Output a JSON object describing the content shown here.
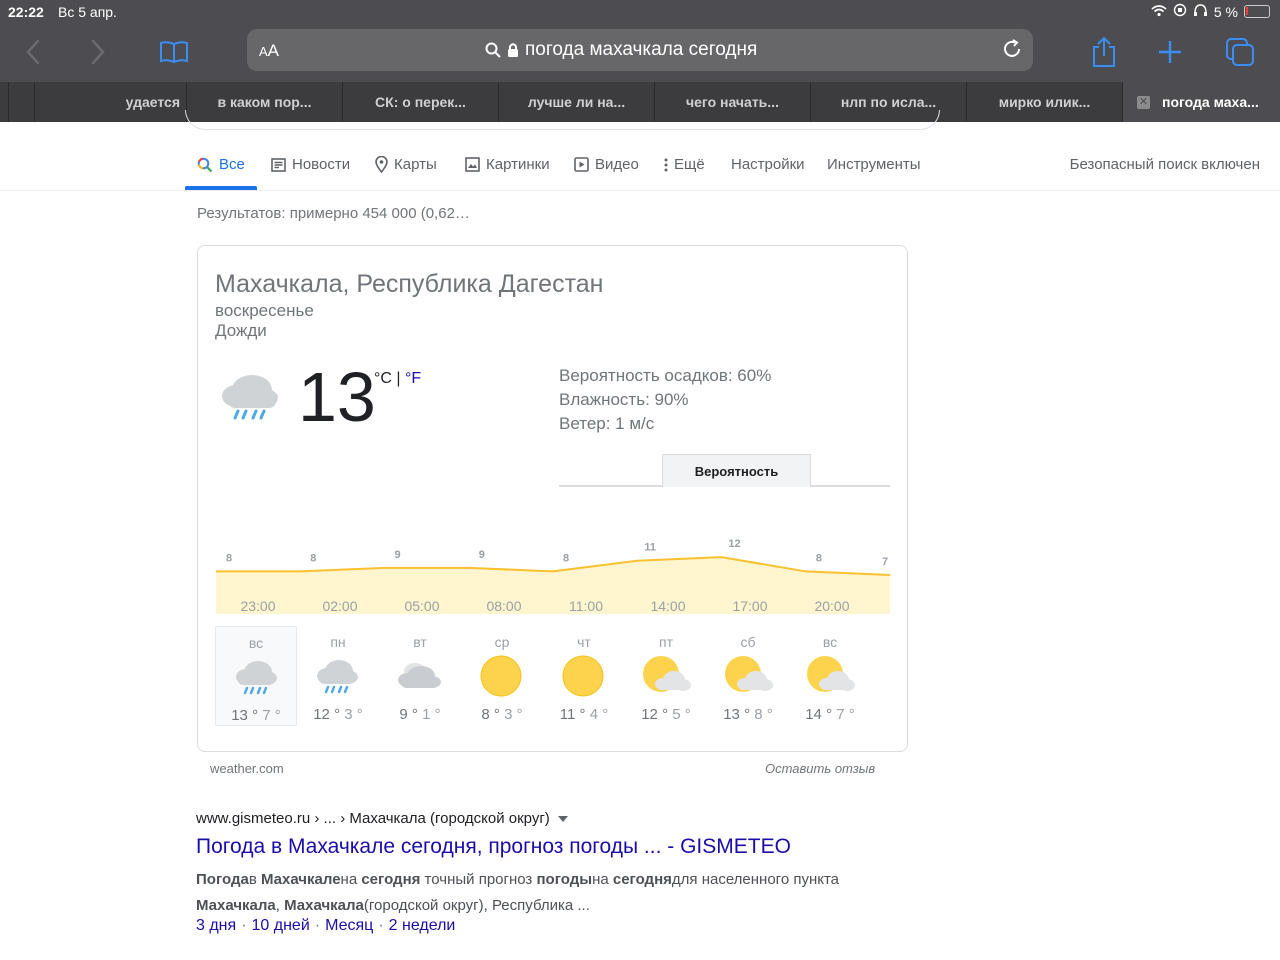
{
  "status_bar": {
    "time": "22:22",
    "date": "Вс 5 апр.",
    "battery": "5 %"
  },
  "address_bar": {
    "text_size_label": "AA",
    "url": "погода махачкала сегодня"
  },
  "tabs": [
    {
      "label": "удается"
    },
    {
      "label": "в каком пор..."
    },
    {
      "label": "СК: о перек..."
    },
    {
      "label": "лучше ли на..."
    },
    {
      "label": "чего начать..."
    },
    {
      "label": "нлп по исла..."
    },
    {
      "label": "мирко илик..."
    },
    {
      "label": "погода маха..."
    }
  ],
  "nav": {
    "items": [
      "Все",
      "Новости",
      "Карты",
      "Картинки",
      "Видео",
      "Ещё",
      "Настройки",
      "Инструменты"
    ],
    "safe_search": "Безопасный поиск включен"
  },
  "result_stats": "Результатов: примерно 454 000 (0,62…",
  "weather": {
    "location": "Махачкала, Республика Дагестан",
    "day": "воскресенье",
    "condition": "Дожди",
    "temp": "13",
    "unit_c": "°C",
    "unit_sep": "|",
    "unit_f": "°F",
    "precip": "Вероятность осадков: 60%",
    "humidity": "Влажность: 90%",
    "wind": "Ветер: 1 м/с",
    "tab_active": "Вероятность",
    "source": "weather.com",
    "feedback": "Оставить отзыв",
    "days": [
      {
        "name": "вс",
        "hi": "13",
        "lo": "7",
        "icon": "rain-icon"
      },
      {
        "name": "пн",
        "hi": "12",
        "lo": "3",
        "icon": "rain-icon"
      },
      {
        "name": "вт",
        "hi": "9",
        "lo": "1",
        "icon": "cloudy-icon"
      },
      {
        "name": "ср",
        "hi": "8",
        "lo": "3",
        "icon": "sun-icon"
      },
      {
        "name": "чт",
        "hi": "11",
        "lo": "4",
        "icon": "sun-icon"
      },
      {
        "name": "пт",
        "hi": "12",
        "lo": "5",
        "icon": "partly-cloudy-icon"
      },
      {
        "name": "сб",
        "hi": "13",
        "lo": "8",
        "icon": "partly-cloudy-icon"
      },
      {
        "name": "вс",
        "hi": "14",
        "lo": "7",
        "icon": "partly-cloudy-icon"
      }
    ]
  },
  "chart_data": {
    "type": "area",
    "x": [
      "23:00",
      "02:00",
      "05:00",
      "08:00",
      "11:00",
      "14:00",
      "17:00",
      "20:00"
    ],
    "point_labels": [
      8,
      8,
      9,
      9,
      8,
      11,
      12,
      8,
      7
    ],
    "series": [
      {
        "values": [
          8,
          8,
          9,
          9,
          8,
          11,
          12,
          8,
          7
        ]
      }
    ],
    "colors": {
      "line": "#fbc02d",
      "fill": "#fff6cf"
    }
  },
  "result": {
    "cite": "www.gismeteo.ru › ... › Махачкала (городской округ)",
    "title": "Погода в Махачкале сегодня, прогноз погоды ... - GISMETEO",
    "snippet_parts": [
      {
        "t": "Погода",
        "b": true
      },
      {
        "t": "в ",
        "b": false
      },
      {
        "t": "Махачкале",
        "b": true
      },
      {
        "t": "на ",
        "b": false
      },
      {
        "t": "сегодня",
        "b": true
      },
      {
        "t": " точный прогноз ",
        "b": false
      },
      {
        "t": "погоды",
        "b": true
      },
      {
        "t": "на ",
        "b": false
      },
      {
        "t": "сегодня",
        "b": true
      },
      {
        "t": "для населенного пункта ",
        "b": false
      },
      {
        "t": "Махачкала",
        "b": true
      },
      {
        "t": ", ",
        "b": false
      },
      {
        "t": "Махачкала",
        "b": true
      },
      {
        "t": "(городской округ), Республика ...",
        "b": false
      }
    ],
    "links": [
      "3 дня",
      "10 дней",
      "Месяц",
      "2 недели"
    ],
    "link_sep": "·"
  }
}
